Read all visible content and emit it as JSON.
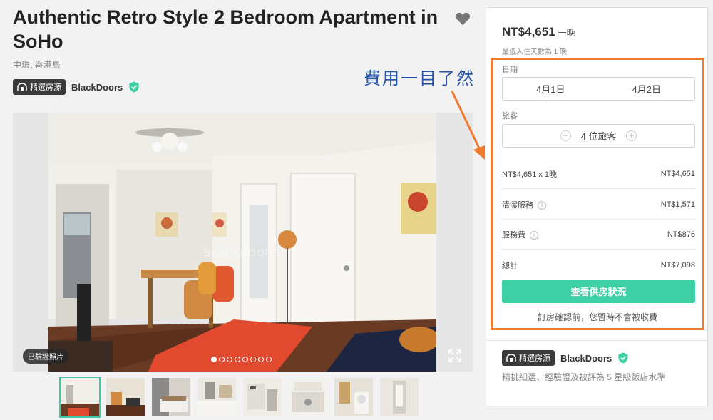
{
  "listing": {
    "title": "Authentic Retro Style 2 Bedroom Apartment in SoHo",
    "location": "中環, 香港島",
    "badge_label": "精選房源",
    "host_name": "BlackDoors"
  },
  "photo": {
    "verified_label": "已驗證照片",
    "watermark": "BLACKDOORS",
    "dot_count": 8,
    "active_dot": 1,
    "thumbnail_count": 8,
    "active_thumbnail": 1
  },
  "annotation": {
    "text": "費用一目了然",
    "color": "#2752a8",
    "arrow_color": "#f07a2e"
  },
  "booking": {
    "price": "NT$4,651",
    "per_night": "一晚",
    "min_stay": "最低入住天數為 1 晚",
    "dates_label": "日期",
    "checkin": "4月1日",
    "checkout": "4月2日",
    "guests_label": "旅客",
    "guests_value": "4 位旅客",
    "fees": [
      {
        "label": "NT$4,651 x 1晚",
        "amount": "NT$4,651",
        "info": false
      },
      {
        "label": "清潔服務",
        "amount": "NT$1,571",
        "info": true
      },
      {
        "label": "服務費",
        "amount": "NT$876",
        "info": true
      },
      {
        "label": "總計",
        "amount": "NT$7,098",
        "info": false
      }
    ],
    "cta_label": "查看供房狀況",
    "no_charge_note": "訂房確認前，您暫時不會被收費",
    "host_badge": "精選房源",
    "host_name": "BlackDoors",
    "host_desc": "精挑細選、經驗證及被評為 5 星級飯店水準",
    "accent_color": "#3ecfa4",
    "highlight_color": "#f07a2e"
  }
}
